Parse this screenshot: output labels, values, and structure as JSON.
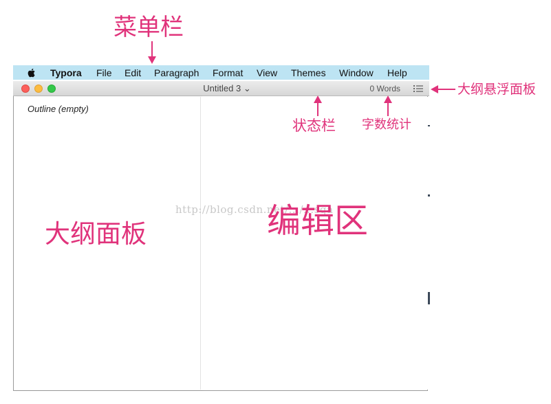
{
  "menubar": {
    "items": [
      "Typora",
      "File",
      "Edit",
      "Paragraph",
      "Format",
      "View",
      "Themes",
      "Window",
      "Help"
    ]
  },
  "window": {
    "title": "Untitled 3 ⌄",
    "word_count": "0 Words"
  },
  "outline": {
    "empty_text": "Outline (empty)"
  },
  "watermark": "http://blog.csdn.net/.../...sqa",
  "annotations": {
    "menu_bar": "菜单栏",
    "floating_outline": "大纲悬浮面板",
    "status_bar": "状态栏",
    "word_count": "字数统计",
    "outline_panel": "大纲面板",
    "editor_area": "编辑区"
  },
  "colors": {
    "menubar_bg": "#bde4f3",
    "annotation": "#e0337b"
  },
  "icons": {
    "apple": "apple-logo-icon",
    "outline_toggle": "list-icon"
  }
}
